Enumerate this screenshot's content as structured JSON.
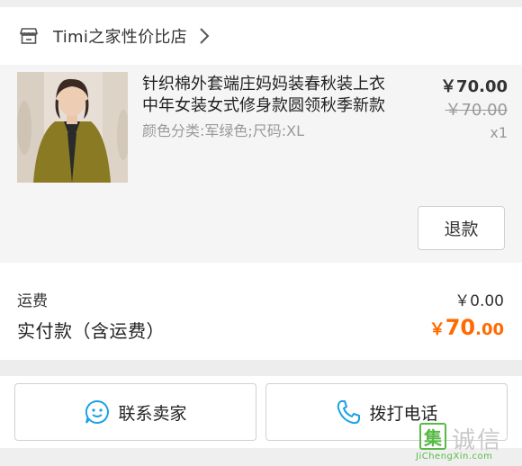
{
  "shop": {
    "name": "Timi之家性价比店",
    "icon": "store-icon"
  },
  "product": {
    "title_line1": "针织棉外套端庄妈妈装春秋装上衣",
    "title_line2": "中年女装女式修身款圆领秋季新款",
    "variant": "颜色分类:军绿色;尺码:XL",
    "price": "￥70.00",
    "original_price": "￥70.00",
    "quantity": "x1",
    "refund_label": "退款"
  },
  "summary": {
    "shipping_label": "运费",
    "shipping_value": "￥0.00",
    "paid_label": "实付款（含运费）",
    "paid_currency": "￥",
    "paid_integer": "70",
    "paid_decimal": ".00"
  },
  "actions": {
    "contact_label": "联系卖家",
    "call_label": "拨打电话"
  },
  "watermark": {
    "char": "集",
    "name": "诚信",
    "url": "JiChengXin.com"
  },
  "colors": {
    "accent": "#ff6a00",
    "icon_blue": "#1aa1e6",
    "watermark_green": "#58b947"
  }
}
